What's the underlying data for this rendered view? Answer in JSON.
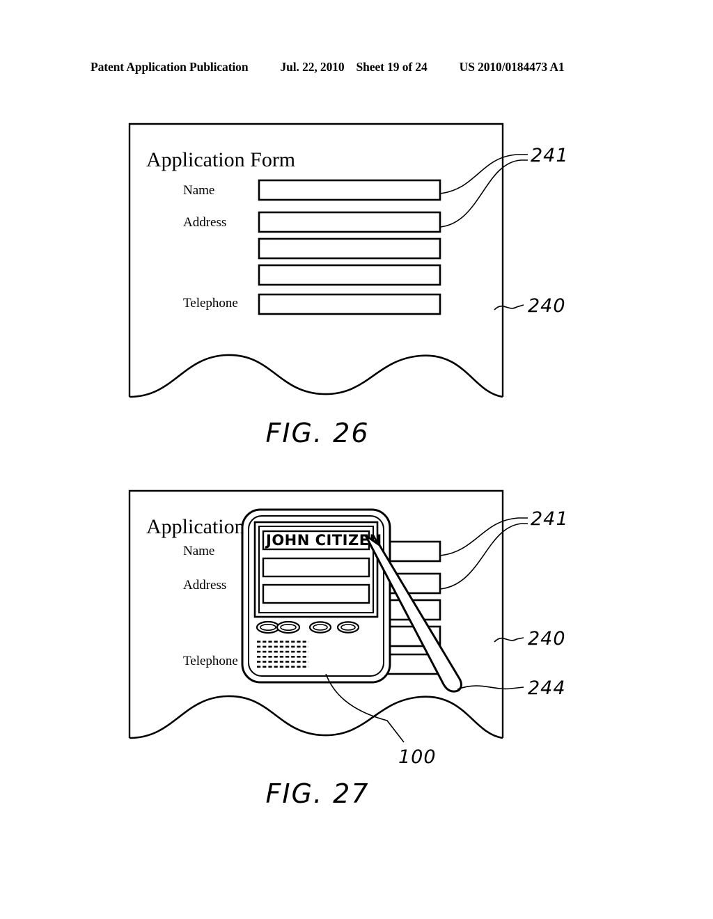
{
  "header": {
    "publication": "Patent Application Publication",
    "date": "Jul. 22, 2010",
    "sheet": "Sheet 19 of 24",
    "patent_number": "US 2010/0184473 A1"
  },
  "figures": [
    {
      "caption": "FIG. 26",
      "form": {
        "title": "Application Form",
        "fields": [
          {
            "label": "Name"
          },
          {
            "label": "Address"
          },
          {
            "label": ""
          },
          {
            "label": ""
          },
          {
            "label": "Telephone"
          }
        ]
      },
      "reference_numerals": [
        {
          "id": "241",
          "text": "241"
        },
        {
          "id": "240",
          "text": "240"
        }
      ]
    },
    {
      "caption": "FIG. 27",
      "form": {
        "title": "Application Form",
        "fields": [
          {
            "label": "Name"
          },
          {
            "label": "Address"
          },
          {
            "label": ""
          },
          {
            "label": ""
          },
          {
            "label": "Telephone"
          }
        ]
      },
      "device": {
        "handwriting": "JOHN CITIZEN",
        "button_count": 4,
        "screen_field_count": 3
      },
      "reference_numerals": [
        {
          "id": "241",
          "text": "241"
        },
        {
          "id": "240",
          "text": "240"
        },
        {
          "id": "244",
          "text": "244"
        },
        {
          "id": "100",
          "text": "100"
        }
      ]
    }
  ]
}
